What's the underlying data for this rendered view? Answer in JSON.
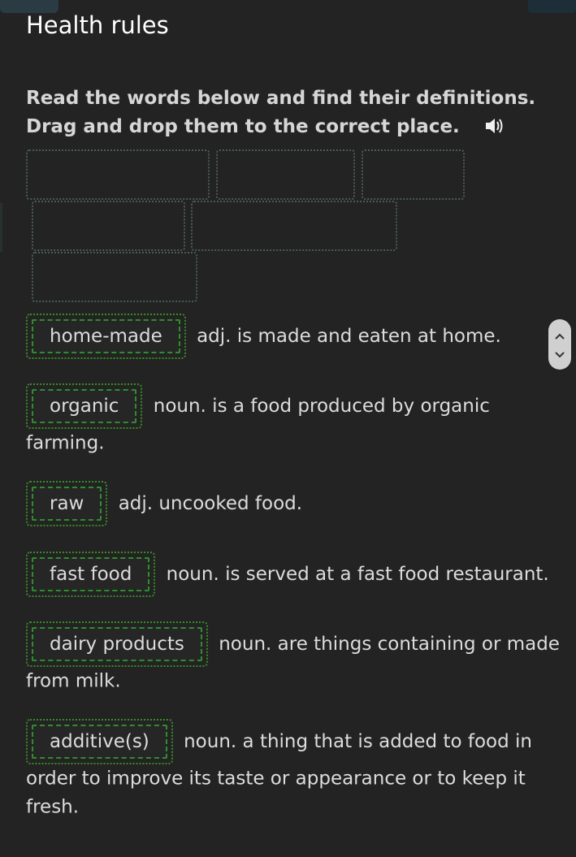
{
  "page": {
    "title": "Health rules",
    "instructions_line1": "Read the words below and find their definitions.",
    "instructions_line2": "Drag and drop them to the correct place.",
    "speaker_icon": "speaker-icon"
  },
  "drop_zone_count": 6,
  "items": [
    {
      "word": "home-made",
      "definition": "adj. is made and eaten at home."
    },
    {
      "word": "organic",
      "definition": "noun. is a food produced by organic farming."
    },
    {
      "word": "raw",
      "definition": "adj. uncooked food."
    },
    {
      "word": "fast food",
      "definition": "noun. is served at a fast food restaurant."
    },
    {
      "word": "dairy products",
      "definition": "noun. are things containing or made from milk."
    },
    {
      "word": "additive(s)",
      "definition": "noun. a thing that is added to food in order to improve its taste or appearance or to keep it fresh."
    }
  ],
  "scroller": {
    "up_icon": "chevron-up-icon",
    "down_icon": "chevron-down-icon"
  },
  "colors": {
    "background": "#232323",
    "chip_border": "#2e8e2e",
    "drop_zone_border": "#4a5a5a"
  }
}
